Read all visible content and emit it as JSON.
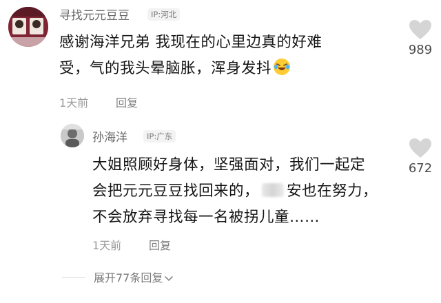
{
  "comment": {
    "author": "寻找元元豆豆",
    "ip_location": "IP:河北",
    "text_lines": [
      "感谢海洋兄弟   我现在的心里边真的好难",
      "受，气的我头晕脑胀，浑身发抖"
    ],
    "emoji": "laughing-crying-emoji",
    "time": "1天前",
    "reply_label": "回复",
    "likes": "989"
  },
  "reply": {
    "author": "孙海洋",
    "ip_location": "IP:广东",
    "text_lines": [
      "大姐照顾好身体，坚强面对，我们一起定",
      "会把元元豆豆找回来的，",
      "安也在努力，",
      "不会放弃寻找每一名被拐儿童……"
    ],
    "time": "1天前",
    "reply_label": "回复",
    "likes": "672"
  },
  "expand_replies": "展开77条回复",
  "colors": {
    "background": "#ffffff",
    "text": "#151515",
    "muted": "#9a9a9a",
    "heart": "#d5d5d5"
  }
}
